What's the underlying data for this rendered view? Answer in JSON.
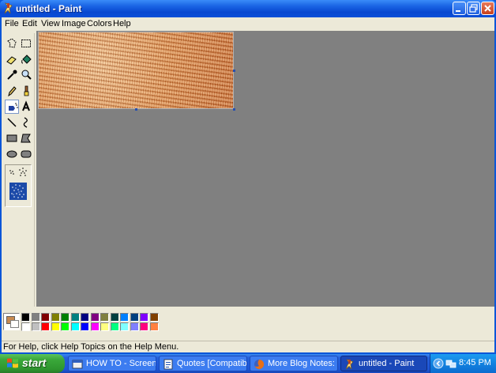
{
  "window": {
    "title": "untitled - Paint",
    "icon": "paint-app-icon",
    "controls": [
      "minimize-icon",
      "restore-icon",
      "close-icon"
    ]
  },
  "menu": {
    "items": [
      "File",
      "Edit",
      "View",
      "Image",
      "Colors",
      "Help"
    ]
  },
  "tools": [
    {
      "name": "free-form-select",
      "icon": "free-select-icon"
    },
    {
      "name": "select",
      "icon": "rect-select-icon"
    },
    {
      "name": "eraser",
      "icon": "eraser-icon"
    },
    {
      "name": "fill-with-color",
      "icon": "fill-bucket-icon"
    },
    {
      "name": "pick-color",
      "icon": "eyedropper-icon"
    },
    {
      "name": "magnifier",
      "icon": "magnifier-icon"
    },
    {
      "name": "pencil",
      "icon": "pencil-icon"
    },
    {
      "name": "brush",
      "icon": "brush-icon"
    },
    {
      "name": "airbrush",
      "icon": "airbrush-icon",
      "active": true
    },
    {
      "name": "text",
      "icon": "text-icon"
    },
    {
      "name": "line",
      "icon": "line-icon"
    },
    {
      "name": "curve",
      "icon": "curve-icon"
    },
    {
      "name": "rectangle",
      "icon": "rectangle-icon"
    },
    {
      "name": "polygon",
      "icon": "polygon-icon"
    },
    {
      "name": "ellipse",
      "icon": "ellipse-icon"
    },
    {
      "name": "rounded-rectangle",
      "icon": "rounded-rect-icon"
    }
  ],
  "tool_options": {
    "icons": [
      "airbrush-small-icon",
      "airbrush-medium-icon",
      "airbrush-large-icon"
    ]
  },
  "palette": {
    "foreground": "#c88a50",
    "background": "#ffffff",
    "top_row": [
      "#000000",
      "#808080",
      "#800000",
      "#808000",
      "#008000",
      "#008080",
      "#000080",
      "#800080",
      "#808040",
      "#004040",
      "#0080ff",
      "#004080",
      "#8000ff",
      "#804000"
    ],
    "bottom_row": [
      "#ffffff",
      "#c0c0c0",
      "#ff0000",
      "#ffff00",
      "#00ff00",
      "#00ffff",
      "#0000ff",
      "#ff00ff",
      "#ffff80",
      "#00ff80",
      "#80ffff",
      "#8080ff",
      "#ff0080",
      "#ff8040"
    ]
  },
  "status": {
    "text": "For Help, click Help Topics on the Help Menu."
  },
  "taskbar": {
    "start_label": "start",
    "tasks": [
      {
        "label": "HOW TO - Screen ...",
        "icon": "folder-window-icon",
        "active": false
      },
      {
        "label": "Quotes [Compatibil...",
        "icon": "document-window-icon",
        "active": false
      },
      {
        "label": "More Blog Notes: ...",
        "icon": "firefox-icon",
        "active": false
      },
      {
        "label": "untitled - Paint",
        "icon": "paint-app-icon",
        "active": true
      }
    ],
    "tray_icons": [
      "back-arrow-icon",
      "network-icon"
    ],
    "clock": "8:45 PM"
  }
}
